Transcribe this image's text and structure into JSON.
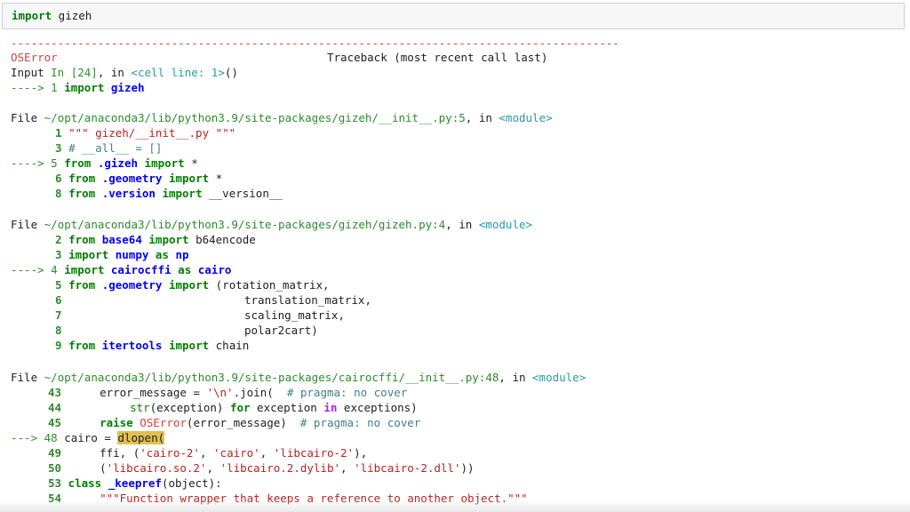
{
  "cell": {
    "code_kw": "import",
    "code_rest": " gizeh"
  },
  "tb": {
    "dashes": "-------------------------------------------------------------------------------------------",
    "error_name": "OSError",
    "traceback_label": "Traceback (most recent call last)",
    "input_label": "Input ",
    "input_ref": "In [24]",
    "in_word": ", in ",
    "cell_line": "<cell line: 1>",
    "cell_parens": "()",
    "arrow_line_1": "----> 1 ",
    "import_kw": "import",
    "gizeh_mod": "gizeh"
  },
  "frames": [
    {
      "file_label": "File ",
      "path": "~/opt/anaconda3/lib/python3.9/site-packages/gizeh/__init__.py:5",
      "in_word": ", in ",
      "module": "<module>"
    },
    {
      "file_label": "File ",
      "path": "~/opt/anaconda3/lib/python3.9/site-packages/gizeh/gizeh.py:4",
      "in_word": ", in ",
      "module": "<module>"
    },
    {
      "file_label": "File ",
      "path": "~/opt/anaconda3/lib/python3.9/site-packages/cairocffi/__init__.py:48",
      "in_word": ", in ",
      "module": "<module>"
    }
  ],
  "code": {
    "f1": [
      "1 ",
      "\"\"\" gizeh/__init__.py \"\"\"",
      "3 ",
      "# __all__ = []",
      "----> 5 ",
      "from",
      " .gizeh ",
      "import",
      " *",
      "6 ",
      "from",
      " .geometry ",
      "import",
      " *",
      "8 ",
      "from",
      " .version ",
      "import",
      " __version__"
    ],
    "f2": [
      "2 ",
      "from",
      " base64 ",
      "import",
      " b64encode",
      "3 ",
      "import",
      " numpy ",
      "as",
      " np",
      "----> 4 ",
      "import",
      " cairocffi ",
      "as",
      " cairo",
      "5 ",
      "from",
      " .geometry ",
      "import",
      " (rotation_matrix,",
      "6",
      "translation_matrix,",
      "7",
      "scaling_matrix,",
      "8",
      "polar2cart)",
      "9 ",
      "from",
      " itertools ",
      "import",
      " chain"
    ],
    "f3": [
      "43",
      "error_message = ",
      "'\\n'",
      ".join(  ",
      "# pragma: no cover",
      "44",
      "str",
      "(exception) ",
      "for",
      " exception ",
      "in",
      " exceptions)",
      "45",
      "raise",
      " ",
      "OSError",
      "(error_message)  ",
      "# pragma: no cover",
      "---> 48 ",
      "cairo = ",
      "dlopen(",
      "49",
      "ffi, (",
      "'cairo-2'",
      ", ",
      "'cairo'",
      ", ",
      "'libcairo-2'",
      "),",
      "50",
      "(",
      "'libcairo.so.2'",
      ", ",
      "'libcairo.2.dylib'",
      ", ",
      "'libcairo-2.dll'",
      "))",
      "53 ",
      "class",
      " ",
      "_keepref",
      "(object):",
      "54",
      "\"\"\"Function wrapper that keeps a reference to another object.\"\"\""
    ]
  }
}
